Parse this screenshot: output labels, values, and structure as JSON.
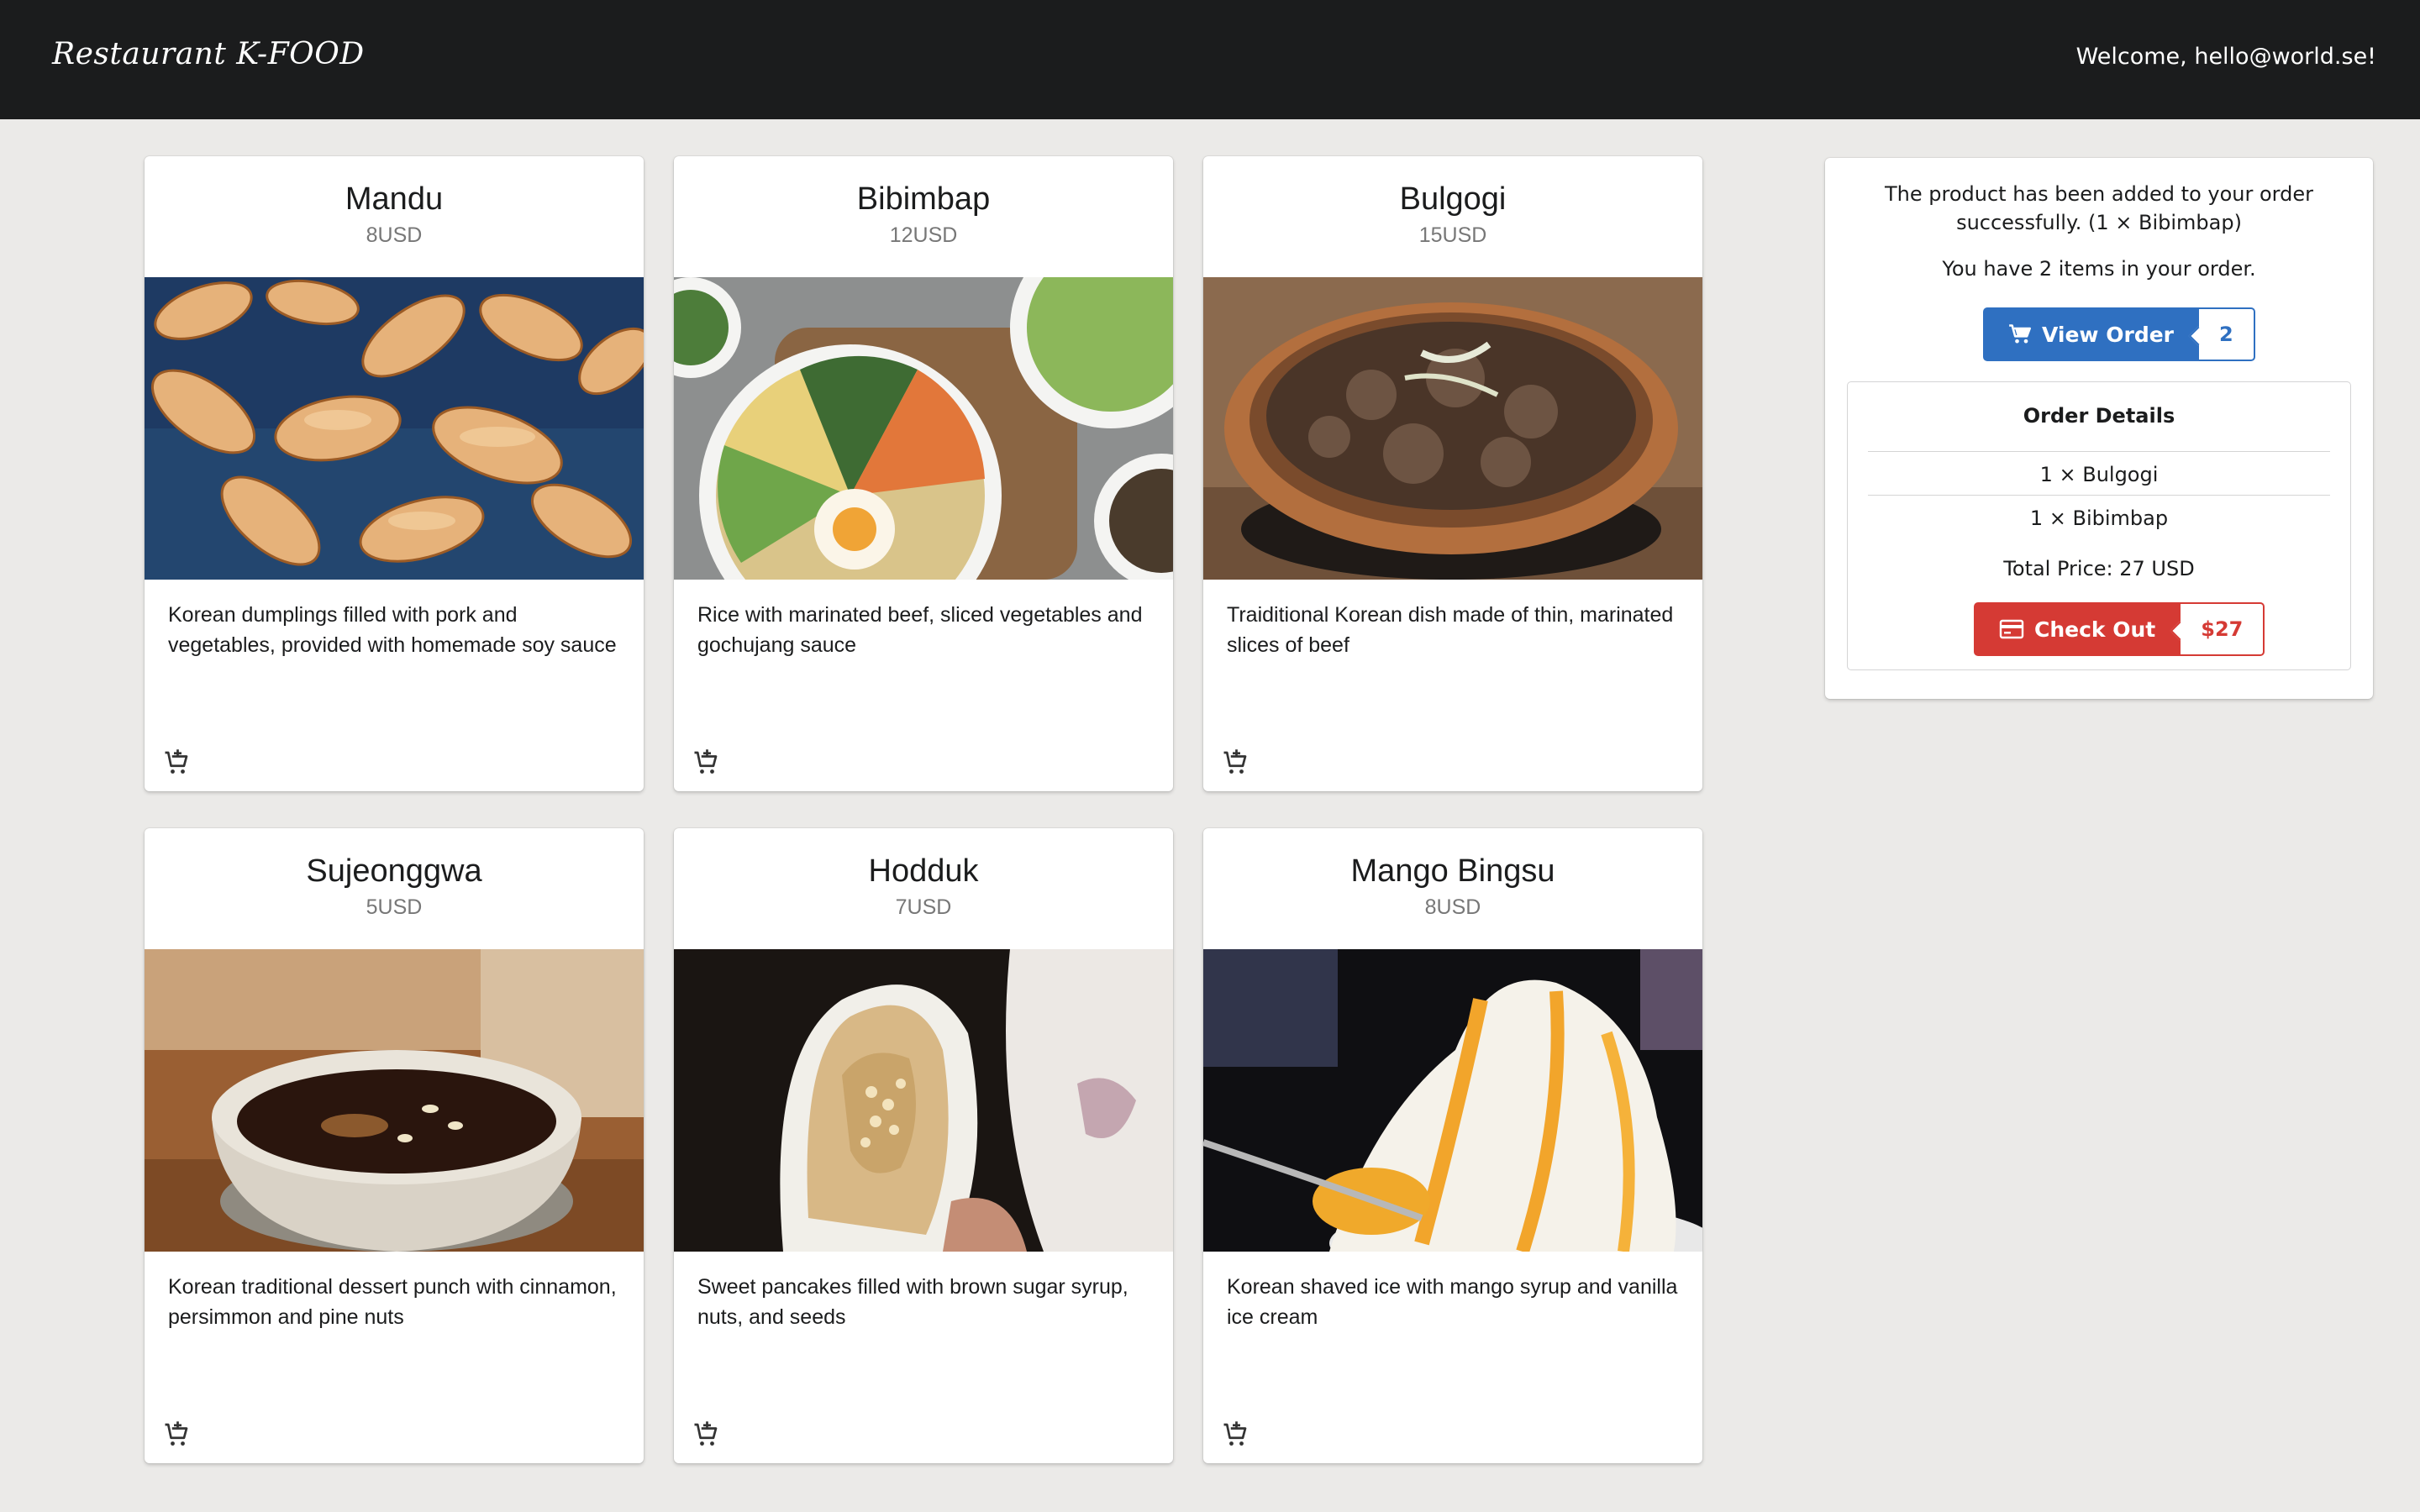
{
  "header": {
    "brand": "Restaurant K-FOOD",
    "welcome": "Welcome, hello@world.se!"
  },
  "products": [
    {
      "name": "Mandu",
      "price": "8USD",
      "description": "Korean dumplings filled with pork and vegetables, provided with homemade soy sauce",
      "image": "dumplings-photo"
    },
    {
      "name": "Bibimbap",
      "price": "12USD",
      "description": "Rice with marinated beef, sliced vegetables and gochujang sauce",
      "image": "bibimbap-bowl-photo"
    },
    {
      "name": "Bulgogi",
      "price": "15USD",
      "description": "Traiditional Korean dish made of thin, marinated slices of beef",
      "image": "bulgogi-pan-photo"
    },
    {
      "name": "Sujeonggwa",
      "price": "5USD",
      "description": "Korean traditional dessert punch with cinnamon, persimmon and pine nuts",
      "image": "punch-bowl-photo"
    },
    {
      "name": "Hodduk",
      "price": "7USD",
      "description": "Sweet pancakes filled with brown sugar syrup, nuts, and seeds",
      "image": "pancake-cup-photo"
    },
    {
      "name": "Mango Bingsu",
      "price": "8USD",
      "description": "Korean shaved ice with mango syrup and vanilla ice cream",
      "image": "shaved-ice-photo"
    }
  ],
  "order_panel": {
    "success_message": "The product has been added to your order successfully. (1 × Bibimbap)",
    "items_message": "You have 2 items in your order.",
    "view_order_label": "View Order",
    "view_order_count": "2",
    "details_title": "Order Details",
    "items": [
      "1 × Bulgogi",
      "1 × Bibimbap"
    ],
    "total": "Total Price: 27 USD",
    "checkout_label": "Check Out",
    "checkout_amount": "$27"
  },
  "icons": {
    "add_to_cart": "cart-plus-icon",
    "view_order": "cart-icon",
    "checkout": "credit-card-icon"
  },
  "colors": {
    "topbar": "#1b1c1d",
    "background": "#ebeae8",
    "blue": "#2f70c1",
    "red": "#d53a34"
  }
}
